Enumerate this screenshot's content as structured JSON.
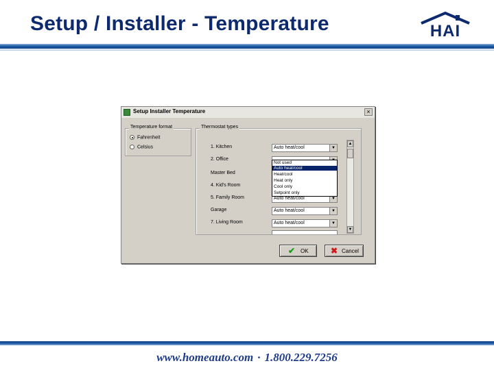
{
  "slide": {
    "title": "Setup / Installer - Temperature",
    "logo_text": "HAI",
    "footer_site": "www.homeauto.com",
    "footer_sep": "·",
    "footer_phone": "1.800.229.7256"
  },
  "dialog": {
    "title": "Setup Installer Temperature",
    "close_label": "×",
    "temperature_format": {
      "label": "Temperature format",
      "options": [
        {
          "label": "Fahrenheit",
          "selected": true
        },
        {
          "label": "Celsius",
          "selected": false
        }
      ]
    },
    "thermostat_types": {
      "label": "Thermostat types",
      "rows": [
        {
          "label": "1. Kitchen",
          "value": "Auto heat/cool"
        },
        {
          "label": "2. Office",
          "value": ""
        },
        {
          "label": "Master Bed",
          "value": ""
        },
        {
          "label": "4. Kid's Room",
          "value": ""
        },
        {
          "label": "5. Family Room",
          "value": "Auto heat/cool"
        },
        {
          "label": "Garage",
          "value": "Auto heat/cool"
        },
        {
          "label": "7. Living Room",
          "value": "Auto heat/cool"
        },
        {
          "label": "",
          "value": ""
        }
      ],
      "dropdown_options": [
        "Not used",
        "Auto heat/cool",
        "Heat/cool",
        "Heat only",
        "Cool only",
        "Setpoint only"
      ],
      "dropdown_selected": "Auto heat/cool"
    },
    "ok_label": "OK",
    "cancel_label": "Cancel"
  },
  "colors": {
    "title": "#0d2a6e",
    "rule": "#1f5fa8",
    "selection": "#0a246a"
  }
}
